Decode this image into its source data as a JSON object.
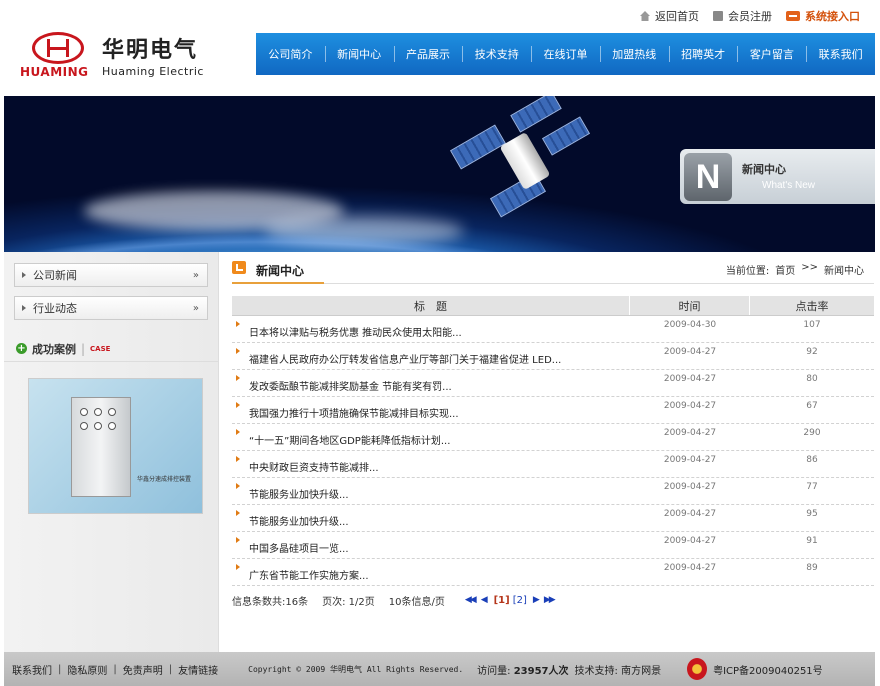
{
  "header": {
    "logo_en": "HUAMING",
    "logo_cn": "华明电气",
    "logo_sub": "Huaming Electric",
    "toplinks": {
      "home": "返回首页",
      "register": "会员注册",
      "login": "系统接入口"
    }
  },
  "nav": [
    "公司简介",
    "新闻中心",
    "产品展示",
    "技术支持",
    "在线订单",
    "加盟热线",
    "招聘英才",
    "客户留言",
    "联系我们"
  ],
  "banner": {
    "badge_letter": "N",
    "badge_title": "新闻中心",
    "badge_sub": "What's New"
  },
  "sidebar": {
    "items": [
      {
        "label": "公司新闻",
        "more": "»"
      },
      {
        "label": "行业动态",
        "more": "»"
      }
    ],
    "case_title": "成功案例",
    "case_sep": "|",
    "case_en": "CASE",
    "case_caption": "华鑫分速成排控装置"
  },
  "main": {
    "title": "新闻中心",
    "breadcrumb": {
      "prefix": "当前位置:",
      "home": "首页",
      "sep": ">>",
      "current": "新闻中心"
    },
    "table": {
      "headers": {
        "title": "标　题",
        "time": "时间",
        "clicks": "点击率"
      },
      "rows": [
        {
          "title": "日本将以津贴与税务优惠 推动民众使用太阳能...",
          "time": "2009-04-30",
          "clicks": "107"
        },
        {
          "title": "福建省人民政府办公厅转发省信息产业厅等部门关于福建省促进 LED...",
          "time": "2009-04-27",
          "clicks": "92"
        },
        {
          "title": "发改委酝酿节能减排奖励基金 节能有奖有罚...",
          "time": "2009-04-27",
          "clicks": "80"
        },
        {
          "title": "我国强力推行十项措施确保节能减排目标实现...",
          "time": "2009-04-27",
          "clicks": "67"
        },
        {
          "title": "“十一五”期间各地区GDP能耗降低指标计划...",
          "time": "2009-04-27",
          "clicks": "290"
        },
        {
          "title": "中央财政巨资支持节能减排...",
          "time": "2009-04-27",
          "clicks": "86"
        },
        {
          "title": "节能服务业加快升级...",
          "time": "2009-04-27",
          "clicks": "77"
        },
        {
          "title": "节能服务业加快升级...",
          "time": "2009-04-27",
          "clicks": "95"
        },
        {
          "title": "中国多晶硅项目一览...",
          "time": "2009-04-27",
          "clicks": "91"
        },
        {
          "title": "广东省节能工作实施方案...",
          "time": "2009-04-27",
          "clicks": "89"
        }
      ]
    },
    "pager": {
      "total": "信息条数共:16条",
      "pages": "页次: 1/2页",
      "per_page": "10条信息/页",
      "first": "◀◀",
      "prev": "◀",
      "current": "[1]",
      "page2": "[2]",
      "next": "▶",
      "last": "▶▶"
    }
  },
  "footer": {
    "links": [
      "联系我们",
      "隐私原则",
      "免责声明",
      "友情链接"
    ],
    "sep": "|",
    "copyright": "Copyright © 2009 华明电气 All Rights Reserved.",
    "visits_label": "访问量:",
    "visits_value": "23957人次",
    "tech": "技术支持: 南方网景",
    "icp": "粤ICP备2009040251号"
  },
  "colors": {
    "nav_blue": "#1068c2",
    "brand_red": "#c8161d",
    "accent_orange": "#f08a1c"
  }
}
